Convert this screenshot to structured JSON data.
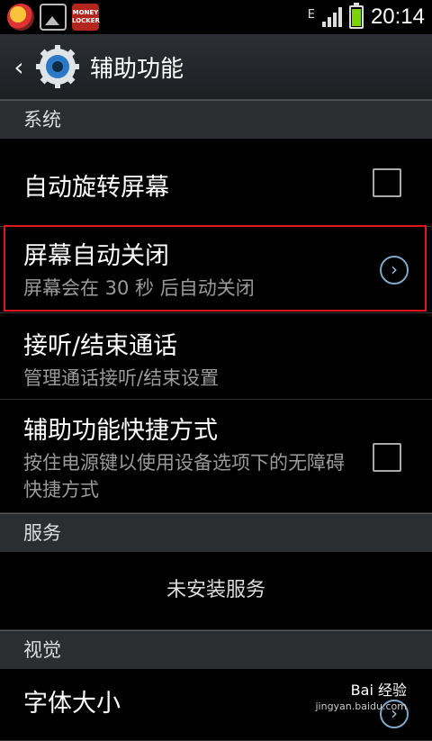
{
  "statusbar": {
    "network_type": "E",
    "time": "20:14",
    "battery_color": "#7bd400",
    "app_icon_3_text": "MONEY LOCKER"
  },
  "header": {
    "title": "辅助功能",
    "back_icon": "chevron-left-icon",
    "app_icon": "gear-icon"
  },
  "sections": {
    "system": "系统",
    "services": "服务",
    "vision": "视觉"
  },
  "system_items": [
    {
      "label": "自动旋转屏幕"
    },
    {
      "label": "屏幕自动关闭",
      "sub": "屏幕会在 30 秒 后自动关闭"
    },
    {
      "label": "接听/结束通话",
      "sub": "管理通话接听/结束设置"
    },
    {
      "label": "辅助功能快捷方式",
      "sub": "按住电源键以使用设备选项下的无障碍快捷方式"
    }
  ],
  "services_empty": "未安装服务",
  "vision_items": [
    {
      "label": "字体大小"
    }
  ],
  "watermark": {
    "text": "Bai 经验",
    "sub": "jingyan.baidu.com"
  },
  "colors": {
    "highlight": "#e0161d",
    "section_bg": "#2a2e31"
  }
}
